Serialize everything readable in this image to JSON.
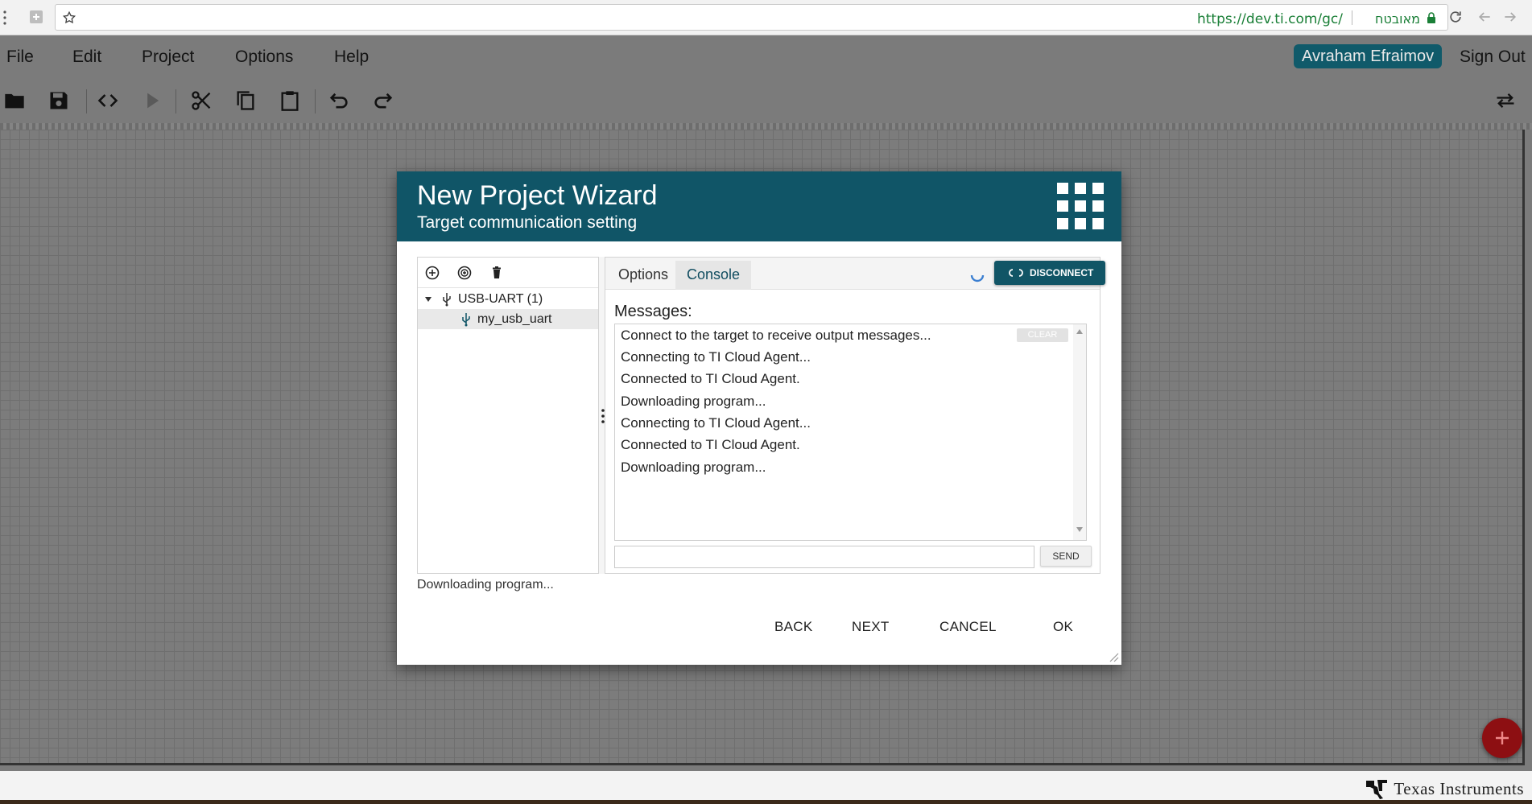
{
  "browser": {
    "url": "https://dev.ti.com/gc/",
    "secure_label": "מאובטח"
  },
  "menubar": {
    "items": [
      "File",
      "Edit",
      "Project",
      "Options",
      "Help"
    ],
    "user_name": "Avraham Efraimov",
    "signout_label": "Sign Out"
  },
  "toolbar": {
    "icons": [
      "folder-open-icon",
      "save-icon",
      "code-icon",
      "run-icon",
      "cut-icon",
      "copy-icon",
      "paste-icon",
      "undo-icon",
      "redo-icon",
      "swap-icon"
    ]
  },
  "dialog": {
    "title": "New Project Wizard",
    "subtitle": "Target communication setting",
    "left_panel": {
      "tree": [
        {
          "label": "USB-UART (1)",
          "expanded": true,
          "selected": false
        },
        {
          "label": "my_usb_uart",
          "expanded": false,
          "selected": true
        }
      ]
    },
    "tabs": [
      {
        "label": "Options",
        "active": false
      },
      {
        "label": "Console",
        "active": true
      }
    ],
    "disconnect_label": "DISCONNECT",
    "messages_label": "Messages:",
    "clear_label": "CLEAR",
    "messages": [
      "Connect to the target to receive output messages...",
      "Connecting to TI Cloud Agent...",
      "Connected to TI Cloud Agent.",
      "Downloading program...",
      "Connecting to TI Cloud Agent...",
      "Connected to TI Cloud Agent.",
      "Downloading program..."
    ],
    "send_input_value": "",
    "send_label": "SEND",
    "status": "Downloading program...",
    "buttons": {
      "back": "BACK",
      "next": "NEXT",
      "cancel": "CANCEL",
      "ok": "OK"
    }
  },
  "footer": {
    "brand": "Texas Instruments"
  },
  "colors": {
    "header_teal": "#105567",
    "badge_teal": "#105a6a",
    "fab_red": "#8d0f12",
    "url_green": "#1a7f37"
  }
}
